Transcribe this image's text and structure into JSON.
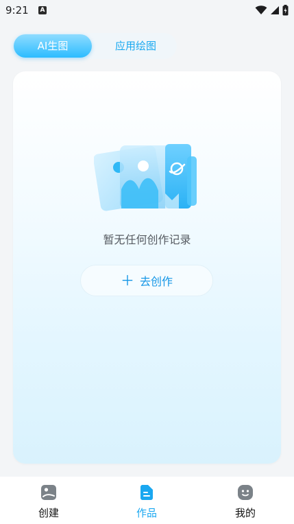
{
  "status": {
    "time": "9:21",
    "keyboard_badge": "A"
  },
  "tabs": [
    {
      "label": "AI生图",
      "active": true
    },
    {
      "label": "应用绘图",
      "active": false
    }
  ],
  "empty": {
    "message": "暂无任何创作记录",
    "button_label": "去创作",
    "button_icon": "plus-icon"
  },
  "nav": [
    {
      "label": "创建",
      "icon": "create-icon",
      "active": false
    },
    {
      "label": "作品",
      "icon": "works-icon",
      "active": true
    },
    {
      "label": "我的",
      "icon": "profile-icon",
      "active": false
    }
  ],
  "colors": {
    "accent": "#1aa7f0",
    "tab_gradient_top": "#8fdcff",
    "tab_gradient_bottom": "#2cbcff",
    "nav_icon_inactive": "#7b8288"
  }
}
